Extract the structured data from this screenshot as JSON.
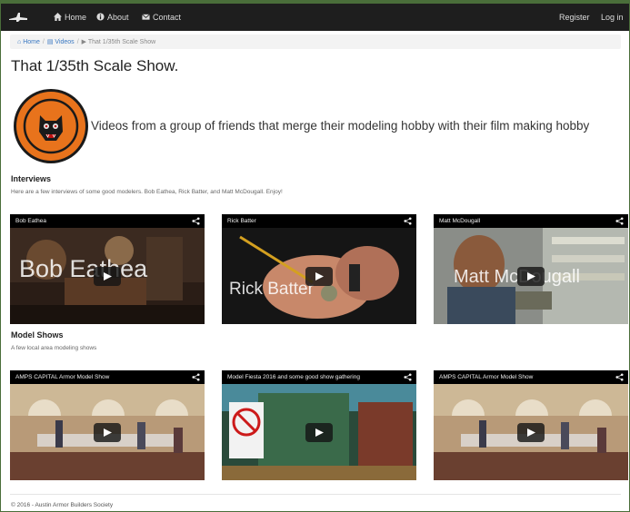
{
  "navbar": {
    "brand_icon": "airplane-logo-icon",
    "links_left": [
      {
        "label": "Home",
        "icon": "home-icon"
      },
      {
        "label": "About",
        "icon": "info-icon"
      },
      {
        "label": "Contact",
        "icon": "envelope-icon"
      }
    ],
    "links_right": [
      {
        "label": "Register"
      },
      {
        "label": "Log in"
      }
    ]
  },
  "breadcrumb": {
    "items": [
      {
        "label": "Home",
        "icon": "home-icon"
      },
      {
        "label": "Videos",
        "icon": "film-icon"
      },
      {
        "label": "That 1/35th Scale Show",
        "icon": "play-icon"
      }
    ]
  },
  "page": {
    "title": "That 1/35th Scale Show.",
    "tagline": "Videos from a group of friends that merge their modeling hobby with their film making hobby"
  },
  "sections": [
    {
      "heading": "Interviews",
      "subtitle": "Here are a few interviews of some good modelers. Bob Eathea, Rick Batter, and Matt McDougall. Enjoy!",
      "videos": [
        {
          "title": "Bob Eathea",
          "overlay": "Bob Eathea"
        },
        {
          "title": "Rick Batter",
          "overlay": "Rick Batter"
        },
        {
          "title": "Matt McDougall",
          "overlay": "Matt McDougall"
        }
      ]
    },
    {
      "heading": "Model Shows",
      "subtitle": "A few local area modeling shows",
      "videos": [
        {
          "title": "AMPS CAPITAL Armor Model Show"
        },
        {
          "title": "Model Fiesta 2016 and some good show gathering"
        },
        {
          "title": "AMPS CAPITAL Armor Model Show"
        }
      ]
    }
  ],
  "footer": {
    "text": "© 2016 - Austin Armor Builders Society"
  },
  "colors": {
    "navbar_bg": "#1e1e1e",
    "link_blue": "#3a78c2",
    "logo_orange": "#e8731c"
  }
}
